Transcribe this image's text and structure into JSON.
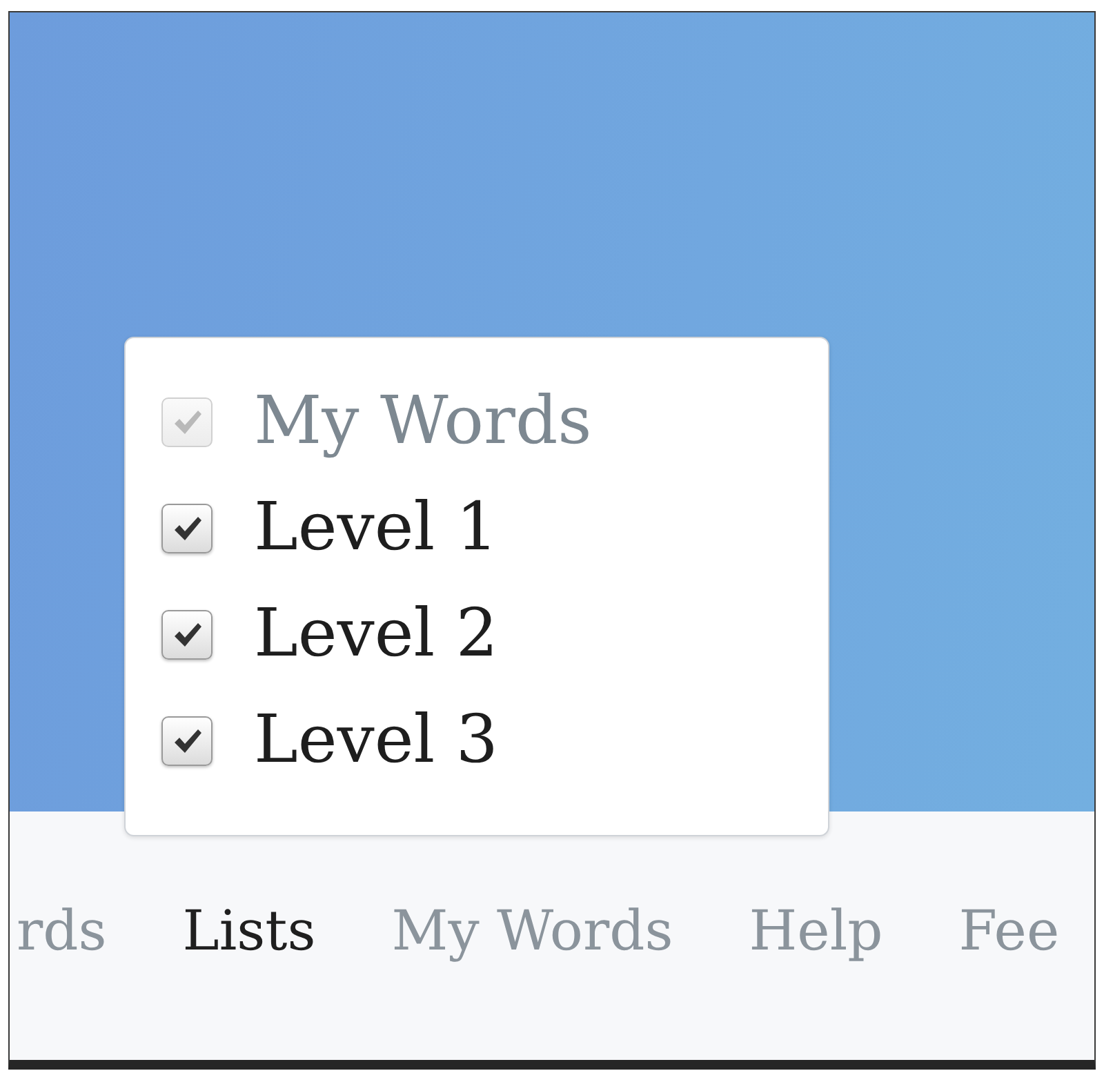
{
  "filter_menu": {
    "items": [
      {
        "label": "My Words",
        "checked": true,
        "disabled": true
      },
      {
        "label": "Level 1",
        "checked": true,
        "disabled": false
      },
      {
        "label": "Level 2",
        "checked": true,
        "disabled": false
      },
      {
        "label": "Level 3",
        "checked": true,
        "disabled": false
      }
    ]
  },
  "nav": {
    "items": [
      {
        "label": "rds",
        "selected": false
      },
      {
        "label": "Lists",
        "selected": true
      },
      {
        "label": "My Words",
        "selected": false
      },
      {
        "label": "Help",
        "selected": false
      },
      {
        "label": "Fee",
        "selected": false
      }
    ]
  }
}
